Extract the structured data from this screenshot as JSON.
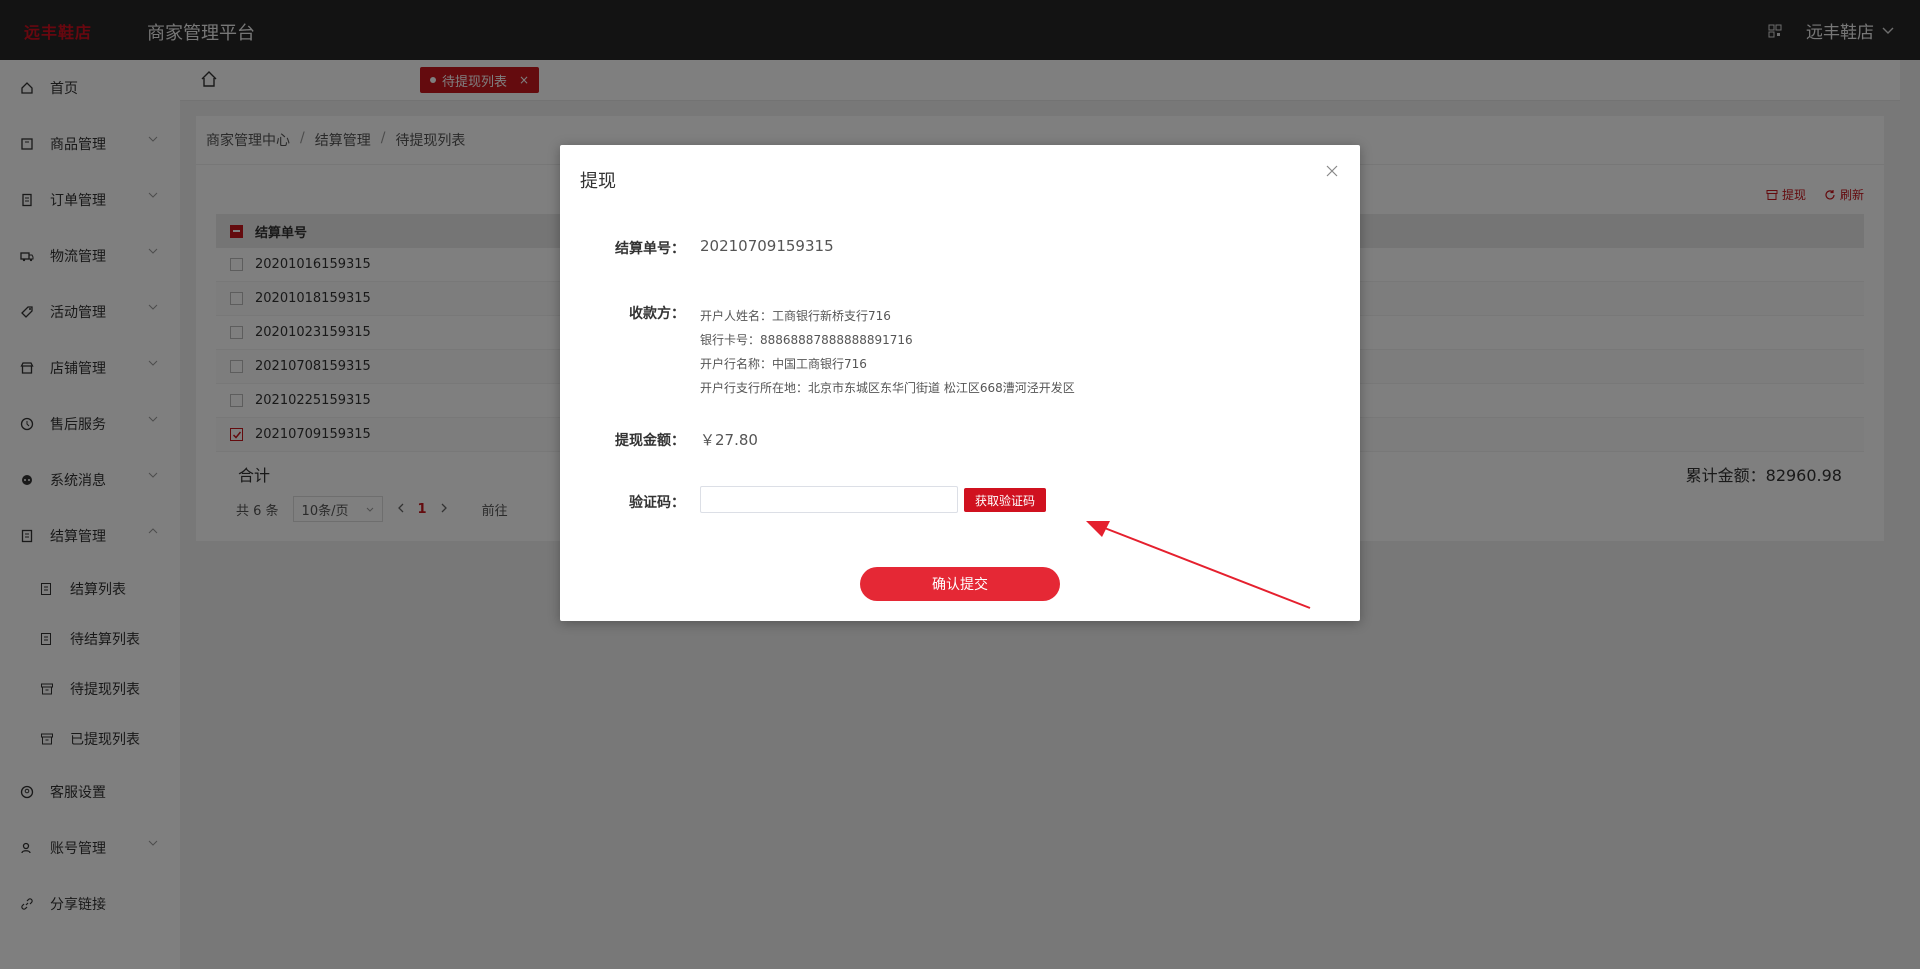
{
  "header": {
    "logo_text": "远丰鞋店",
    "platform_title": "商家管理平台",
    "store_name": "远丰鞋店"
  },
  "sidebar": {
    "items": [
      {
        "label": "首页",
        "icon": "home-icon"
      },
      {
        "label": "商品管理",
        "icon": "goods-icon"
      },
      {
        "label": "订单管理",
        "icon": "order-icon"
      },
      {
        "label": "物流管理",
        "icon": "truck-icon"
      },
      {
        "label": "活动管理",
        "icon": "tag-icon"
      },
      {
        "label": "店铺管理",
        "icon": "store-icon"
      },
      {
        "label": "售后服务",
        "icon": "service-icon"
      },
      {
        "label": "系统消息",
        "icon": "message-icon"
      },
      {
        "label": "结算管理",
        "icon": "settlement-icon"
      }
    ],
    "sub_items": [
      {
        "label": "结算列表"
      },
      {
        "label": "待结算列表"
      },
      {
        "label": "待提现列表"
      },
      {
        "label": "已提现列表"
      }
    ],
    "bottom_items": [
      {
        "label": "客服设置"
      },
      {
        "label": "账号管理"
      },
      {
        "label": "分享链接"
      }
    ]
  },
  "tabs": {
    "active_label": "待提现列表",
    "close_glyph": "×"
  },
  "breadcrumb": [
    "商家管理中心",
    "结算管理",
    "待提现列表"
  ],
  "toolbar": {
    "withdraw_label": "提现",
    "refresh_label": "刷新"
  },
  "table": {
    "header": "结算单号",
    "rows": [
      {
        "id": "20201016159315",
        "checked": false
      },
      {
        "id": "20201018159315",
        "checked": false
      },
      {
        "id": "20201023159315",
        "checked": false
      },
      {
        "id": "20210708159315",
        "checked": false
      },
      {
        "id": "20210225159315",
        "checked": false
      },
      {
        "id": "20210709159315",
        "checked": true
      }
    ],
    "sum_label": "合计",
    "total_label": "累计金额：82960.98"
  },
  "pager": {
    "total_text": "共 6 条",
    "page_size": "10条/页",
    "current_page": "1",
    "goto_text": "前往"
  },
  "modal": {
    "title": "提现",
    "order_label": "结算单号：",
    "order_value": "20210709159315",
    "payee_label": "收款方：",
    "payee_lines": [
      "开户人姓名：工商银行新桥支行716",
      "银行卡号：88868887888888891716",
      "开户行名称：中国工商银行716",
      "开户行支行所在地：北京市东城区东华门街道 松江区668漕河泾开发区"
    ],
    "amount_label": "提现金额：",
    "amount_value": "￥27.80",
    "code_label": "验证码：",
    "code_value": "",
    "get_code_label": "获取验证码",
    "submit_label": "确认提交"
  },
  "colors": {
    "brand": "#c8161d",
    "topbar": "#262626"
  }
}
